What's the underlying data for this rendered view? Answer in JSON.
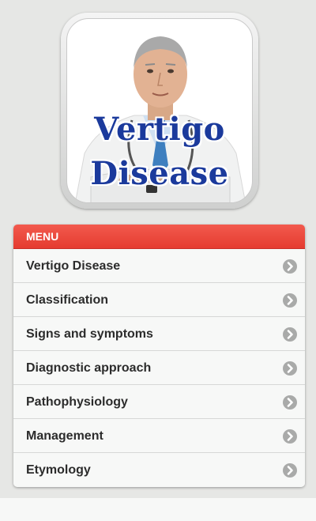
{
  "logo": {
    "title_line1": "Vertigo",
    "title_line2": "Disease",
    "icon": "doctor-portrait",
    "title_color": "#1b3a9c"
  },
  "menu": {
    "header": "MENU",
    "header_color": "#e53b30",
    "items": [
      {
        "label": "Vertigo Disease",
        "icon": "chevron-right-circle-icon"
      },
      {
        "label": "Classification",
        "icon": "chevron-right-circle-icon"
      },
      {
        "label": "Signs and symptoms",
        "icon": "chevron-right-circle-icon"
      },
      {
        "label": "Diagnostic approach",
        "icon": "chevron-right-circle-icon"
      },
      {
        "label": "Pathophysiology",
        "icon": "chevron-right-circle-icon"
      },
      {
        "label": "Management",
        "icon": "chevron-right-circle-icon"
      },
      {
        "label": "Etymology",
        "icon": "chevron-right-circle-icon"
      }
    ]
  }
}
